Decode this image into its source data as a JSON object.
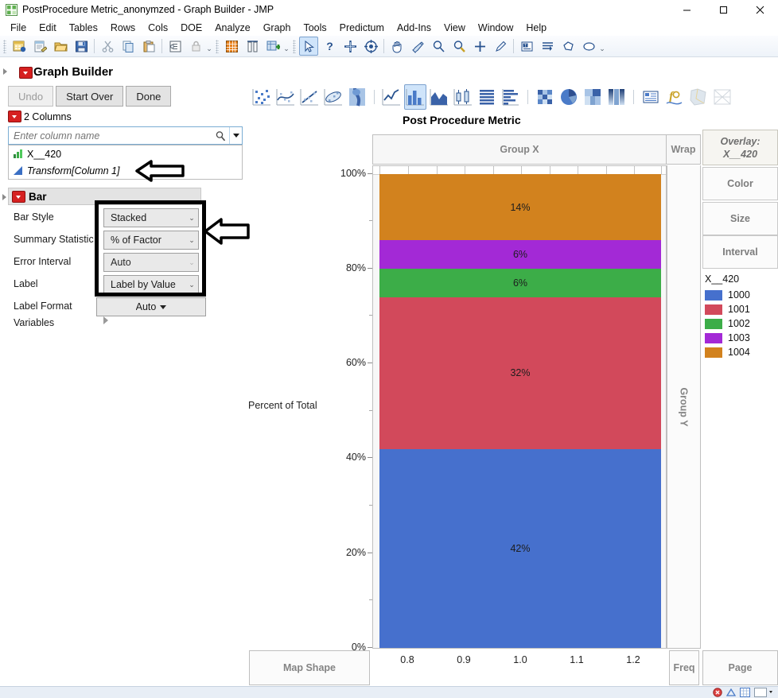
{
  "window": {
    "title": "PostProcedure Metric_anonymzed - Graph Builder - JMP",
    "minimize": "—",
    "maximize": "☐",
    "close": "✕"
  },
  "menubar": {
    "items": [
      "File",
      "Edit",
      "Tables",
      "Rows",
      "Cols",
      "DOE",
      "Analyze",
      "Graph",
      "Tools",
      "Predictum",
      "Add-Ins",
      "View",
      "Window",
      "Help"
    ]
  },
  "toolbar": {
    "groups": [
      {
        "icons": [
          "new-data-table-icon",
          "new-script-icon",
          "open-file-icon",
          "save-icon"
        ]
      },
      {
        "icons": [
          "cut-icon",
          "copy-icon",
          "paste-icon"
        ]
      },
      {
        "icons": [
          "column-info-icon",
          "lock-icon"
        ]
      },
      {
        "icons": [
          "data-table-icon",
          "columns-icon",
          "new-column-icon"
        ]
      },
      {
        "icons": [
          "arrow-select-icon",
          "question-icon",
          "crosshair-icon",
          "target-icon"
        ]
      },
      {
        "icons": [
          "hand-icon",
          "brush-icon",
          "magnifier-icon",
          "zoom-icon",
          "plus-icon",
          "pencil-icon"
        ]
      },
      {
        "icons": [
          "text-annotate-icon",
          "lines-icon",
          "polygon-icon",
          "ellipse-icon"
        ]
      }
    ]
  },
  "graph_builder": {
    "panel_title": "Graph Builder",
    "buttons": {
      "undo": "Undo",
      "start_over": "Start Over",
      "done": "Done"
    },
    "columns_header": "2 Columns",
    "search_placeholder": "Enter column name",
    "column_items": [
      {
        "name": "X__420",
        "type": "continuous",
        "italic": false
      },
      {
        "name": "Transform[Column 1]",
        "type": "transform",
        "italic": true
      }
    ],
    "graph_type_icons": [
      "points-icon",
      "smoother-icon",
      "line-of-fit-icon",
      "ellipse-icon",
      "contour-icon",
      "line-icon",
      "bar-icon",
      "area-icon",
      "box-plot-icon",
      "histogram-icon",
      "heatmap-icon",
      "pie-icon",
      "treemap-icon",
      "mosaic-icon",
      "caption-box-icon",
      "formula-icon",
      "map-shapes-icon",
      "parallel-plot-icon"
    ],
    "selected_graph_type": "bar-icon"
  },
  "bar_panel": {
    "title": "Bar",
    "properties": [
      {
        "label": "Bar Style",
        "value": "Stacked",
        "disabled": false
      },
      {
        "label": "Summary Statistic",
        "value": "% of Factor",
        "disabled": false
      },
      {
        "label": "Error Interval",
        "value": "Auto",
        "disabled": true
      },
      {
        "label": "Label",
        "value": "Label by Value",
        "disabled": false
      }
    ],
    "label_format": {
      "label": "Label Format",
      "value": "Auto"
    },
    "variables": {
      "label": "Variables"
    }
  },
  "drop_zones": {
    "group_x": "Group X",
    "group_y": "Group Y",
    "wrap": "Wrap",
    "overlay_line1": "Overlay:",
    "overlay_line2": "X__420",
    "color": "Color",
    "size": "Size",
    "interval": "Interval",
    "map_shape": "Map Shape",
    "freq": "Freq",
    "page": "Page"
  },
  "legend": {
    "title": "X__420",
    "entries": [
      {
        "label": "1000",
        "color": "#4670cd"
      },
      {
        "label": "1001",
        "color": "#d2495b"
      },
      {
        "label": "1002",
        "color": "#3cad48"
      },
      {
        "label": "1003",
        "color": "#a329d6"
      },
      {
        "label": "1004",
        "color": "#d2821e"
      }
    ]
  },
  "chart_data": {
    "type": "bar",
    "subtype": "stacked-100-percent",
    "title": "Post Procedure Metric",
    "xlabel": "",
    "ylabel": "Percent of Total",
    "categories": [
      "1.0"
    ],
    "x_ticks": [
      "0.8",
      "0.9",
      "1.0",
      "1.1",
      "1.2"
    ],
    "x_tick_values": [
      0.8,
      0.9,
      1.0,
      1.1,
      1.2
    ],
    "xlim": [
      0.75,
      1.25
    ],
    "y_ticks": [
      "0%",
      "20%",
      "40%",
      "60%",
      "80%",
      "100%"
    ],
    "y_tick_values": [
      0,
      20,
      40,
      60,
      80,
      100
    ],
    "ylim": [
      0,
      100
    ],
    "grid": false,
    "legend_position": "right",
    "series": [
      {
        "name": "1000",
        "color": "#4670cd",
        "value": 42,
        "data_label": "42%"
      },
      {
        "name": "1001",
        "color": "#d2495b",
        "value": 32,
        "data_label": "32%"
      },
      {
        "name": "1002",
        "color": "#3cad48",
        "value": 6,
        "data_label": "6%"
      },
      {
        "name": "1003",
        "color": "#a329d6",
        "value": 6,
        "data_label": "6%"
      },
      {
        "name": "1004",
        "color": "#d2821e",
        "value": 14,
        "data_label": "14%"
      }
    ]
  },
  "annotations": [
    {
      "name": "arrow-transform-column",
      "target": "Transform[Column 1]"
    },
    {
      "name": "arrow-bar-controls",
      "target": "Bar control dropdowns"
    }
  ],
  "colors": {
    "accent": "#4670cd",
    "panel_bg": "#e3e3e3",
    "plot_bg": "#f7f7f7",
    "zone_label": "#848484"
  }
}
